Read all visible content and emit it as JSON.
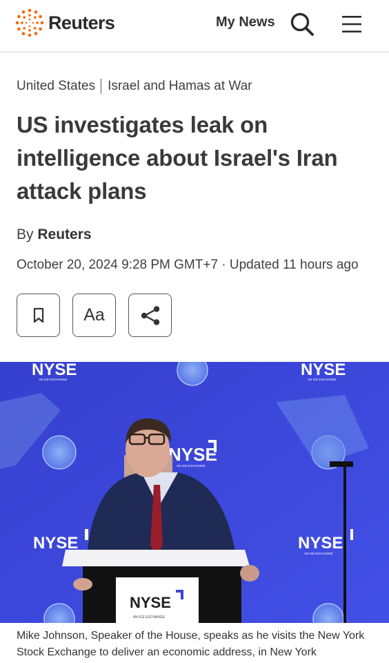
{
  "header": {
    "brand": "Reuters",
    "my_news": "My News",
    "search_icon": "search-icon",
    "menu_icon": "hamburger-menu-icon"
  },
  "breadcrumb": {
    "section": "United States",
    "topic": "Israel and Hamas at War"
  },
  "article": {
    "headline": "US investigates leak on intelligence about Israel's Iran attack plans",
    "by_prefix": "By",
    "author": "Reuters",
    "dateline": "October 20, 2024 9:28 PM GMT+7 · Updated 11 hours ago"
  },
  "toolbar": {
    "bookmark_icon": "bookmark-icon",
    "text_size_label": "Aa",
    "share_icon": "share-icon"
  },
  "photo": {
    "backdrop_logo": "NYSE",
    "backdrop_sub": "AN ICE EXCHANGE",
    "caption": "Mike Johnson, Speaker of the House, speaks as he visits the New York Stock Exchange to deliver an economic address, in New York"
  },
  "colors": {
    "brand_orange": "#fa6400",
    "backdrop_blue": "#3b45d9",
    "text_dark": "#3a3a3a"
  }
}
